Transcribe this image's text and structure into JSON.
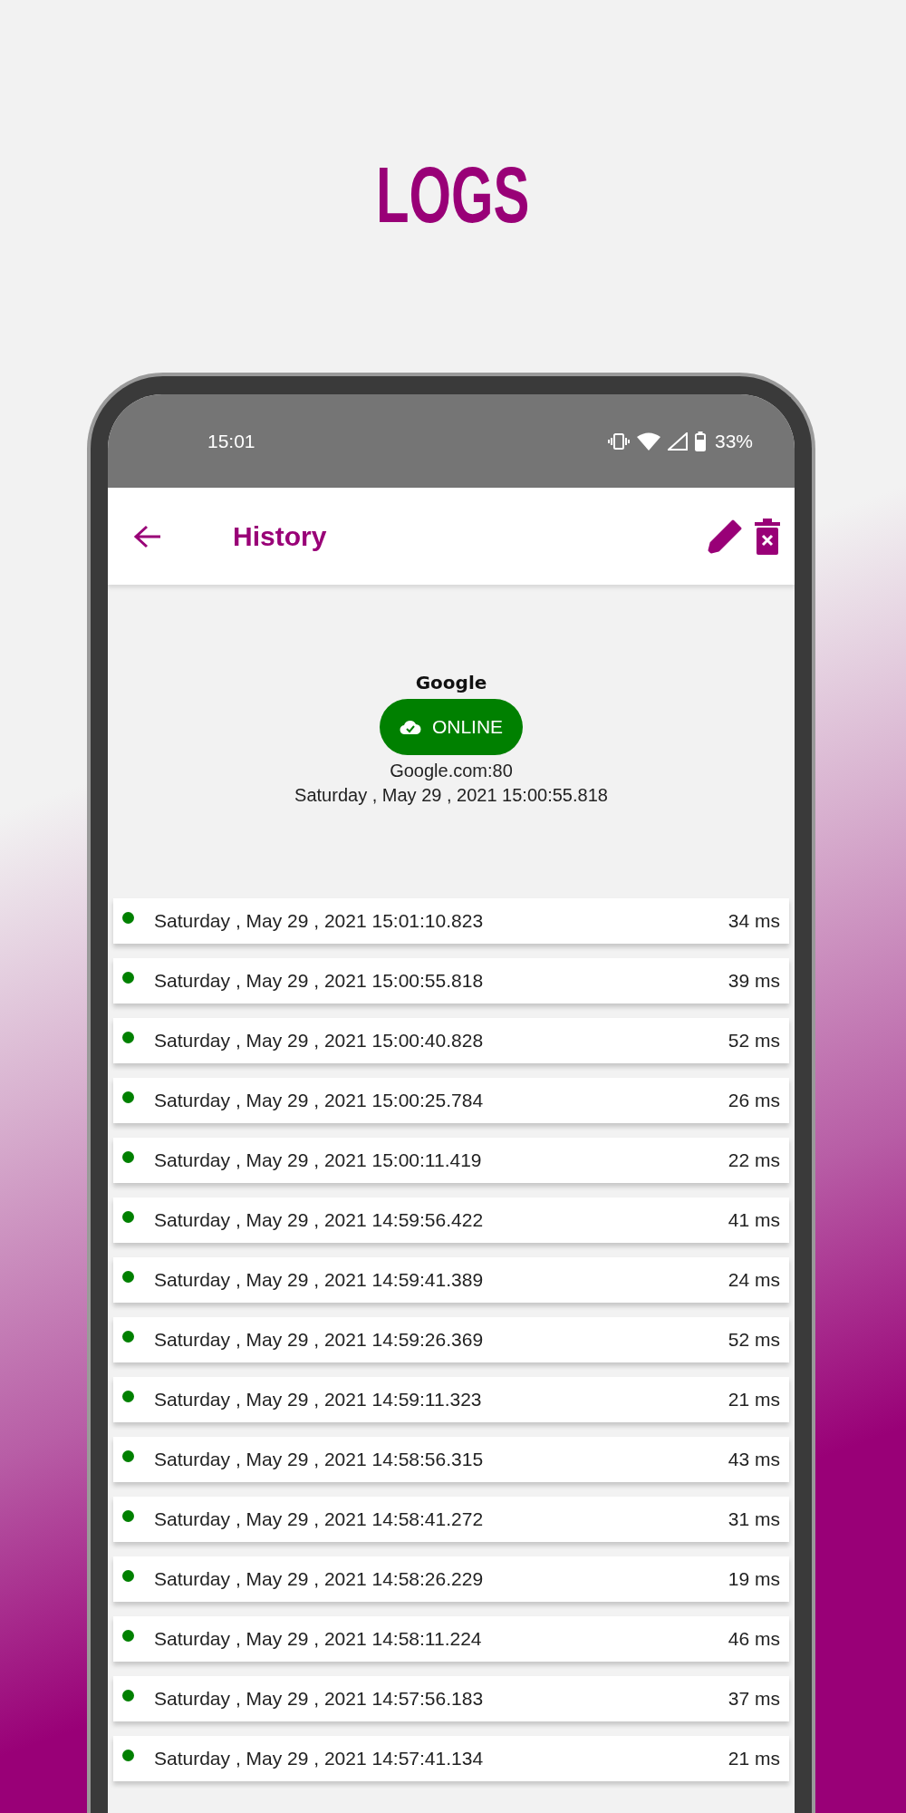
{
  "headline": "LOGS",
  "status_bar": {
    "time": "15:01",
    "battery": "33%"
  },
  "app_bar": {
    "title": "History"
  },
  "host": {
    "name": "Google",
    "status": "ONLINE",
    "address": "Google.com:80",
    "checked_at": "Saturday , May 29 , 2021 15:00:55.818"
  },
  "logs": [
    {
      "time": "Saturday , May 29 , 2021 15:01:10.823",
      "latency": "34 ms"
    },
    {
      "time": "Saturday , May 29 , 2021 15:00:55.818",
      "latency": "39 ms"
    },
    {
      "time": "Saturday , May 29 , 2021 15:00:40.828",
      "latency": "52 ms"
    },
    {
      "time": "Saturday , May 29 , 2021 15:00:25.784",
      "latency": "26 ms"
    },
    {
      "time": "Saturday , May 29 , 2021 15:00:11.419",
      "latency": "22 ms"
    },
    {
      "time": "Saturday , May 29 , 2021 14:59:56.422",
      "latency": "41 ms"
    },
    {
      "time": "Saturday , May 29 , 2021 14:59:41.389",
      "latency": "24 ms"
    },
    {
      "time": "Saturday , May 29 , 2021 14:59:26.369",
      "latency": "52 ms"
    },
    {
      "time": "Saturday , May 29 , 2021 14:59:11.323",
      "latency": "21 ms"
    },
    {
      "time": "Saturday , May 29 , 2021 14:58:56.315",
      "latency": "43 ms"
    },
    {
      "time": "Saturday , May 29 , 2021 14:58:41.272",
      "latency": "31 ms"
    },
    {
      "time": "Saturday , May 29 , 2021 14:58:26.229",
      "latency": "19 ms"
    },
    {
      "time": "Saturday , May 29 , 2021 14:58:11.224",
      "latency": "46 ms"
    },
    {
      "time": "Saturday , May 29 , 2021 14:57:56.183",
      "latency": "37 ms"
    },
    {
      "time": "Saturday , May 29 , 2021 14:57:41.134",
      "latency": "21 ms"
    }
  ]
}
